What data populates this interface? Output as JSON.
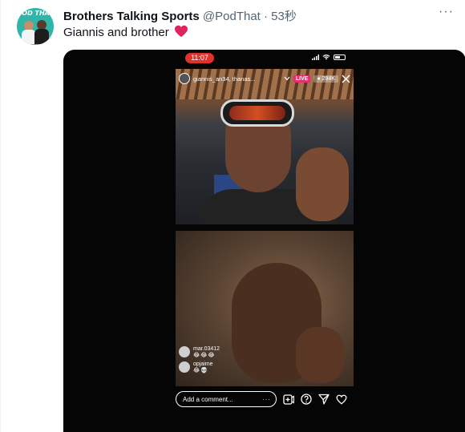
{
  "tweet": {
    "account_name": "Brothers Talking Sports",
    "handle_time": "@PodThat · 53秒",
    "text": "Giannis and brother",
    "avatar_text": "POD THAT",
    "more_label": "···"
  },
  "video": {
    "status_time": "11:07",
    "live": {
      "usernames": "giannis_an34, thanas...",
      "live_label": "LIVE",
      "viewers": "● 294K"
    },
    "comments": [
      {
        "user": "mar.03412",
        "text": "😂😂😂"
      },
      {
        "user": "opjaime",
        "text": "😂💀"
      }
    ],
    "comment_placeholder": "Add a comment...",
    "comment_more": "···"
  },
  "colors": {
    "accent_red": "#e0312b",
    "live_pink": "#e1306c",
    "heart": "#e0245e",
    "avatar_bg": "#2fb6a8"
  }
}
